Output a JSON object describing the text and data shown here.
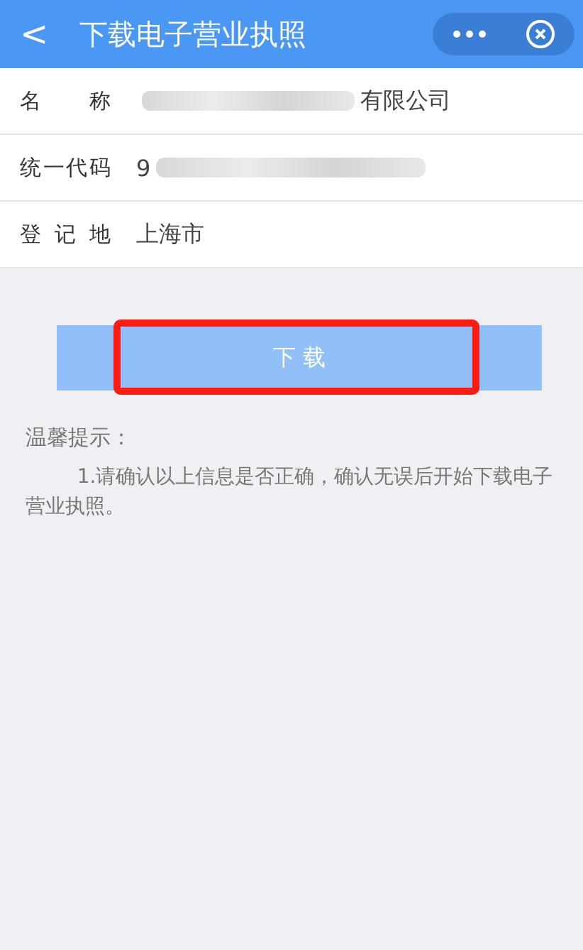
{
  "header": {
    "back_icon": "<",
    "title": "下载电子营业执照"
  },
  "fields": [
    {
      "label": "名 称",
      "value": "有限公司",
      "kind": "headmask"
    },
    {
      "label": "统一代码",
      "value": "9",
      "kind": "tailmask"
    },
    {
      "label": "登 记 地",
      "value": "上海市",
      "kind": "plain"
    }
  ],
  "download_button": {
    "label": "下 载",
    "highlighted": true
  },
  "tips": {
    "title": "温馨提示：",
    "items": [
      "1.请确认以上信息是否正确，确认无误后开始下载电子营业执照。"
    ]
  }
}
